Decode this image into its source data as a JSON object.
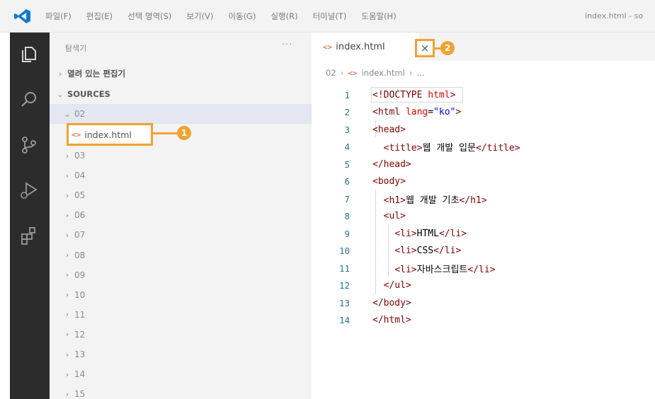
{
  "titlebar": {
    "menu": [
      "파일(F)",
      "편집(E)",
      "선택 영역(S)",
      "보기(V)",
      "이동(G)",
      "실행(R)",
      "터미널(T)",
      "도움말(H)"
    ],
    "window_title": "index.html - so"
  },
  "activitybar": {
    "icons": [
      "explorer-icon",
      "search-icon",
      "source-control-icon",
      "run-debug-icon",
      "extensions-icon"
    ]
  },
  "sidebar": {
    "title": "탐색기",
    "more": "···",
    "open_editors": "열려 있는 편집기",
    "sources": "SOURCES",
    "expanded_folder": "02",
    "file": "index.html",
    "folders": [
      "03",
      "04",
      "05",
      "06",
      "07",
      "08",
      "09",
      "10",
      "11",
      "12",
      "13",
      "14",
      "15"
    ]
  },
  "callouts": [
    "1",
    "2"
  ],
  "editor": {
    "tab_label": "index.html",
    "close_glyph": "×",
    "breadcrumb": {
      "folder": "02",
      "file": "index.html",
      "more": "..."
    },
    "line_numbers": [
      "1",
      "2",
      "3",
      "4",
      "5",
      "6",
      "7",
      "8",
      "9",
      "10",
      "11",
      "12",
      "13",
      "14"
    ]
  },
  "colors": {
    "accent": "#f0a232",
    "activity_bar": "#2c2c2c",
    "vscode_blue": "#0e7ad3",
    "tag": "#800000",
    "attr": "#e50000",
    "string": "#0000ff"
  }
}
